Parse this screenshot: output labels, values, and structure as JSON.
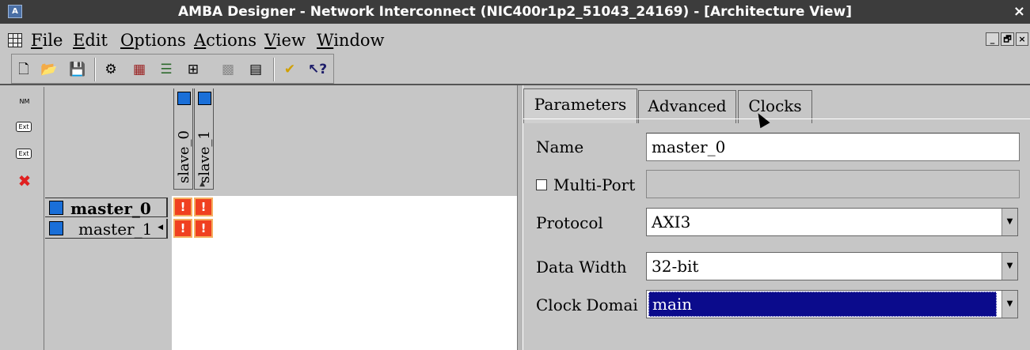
{
  "window": {
    "title": "AMBA Designer - Network Interconnect (NIC400r1p2_51043_24169) - [Architecture View]",
    "close_glyph": "×",
    "app_icon": "A"
  },
  "menubar": {
    "items": [
      {
        "label_u": "F",
        "label_rest": "ile"
      },
      {
        "label_u": "E",
        "label_rest": "dit"
      },
      {
        "label_u": "O",
        "label_rest": "ptions"
      },
      {
        "label_u": "A",
        "label_rest": "ctions"
      },
      {
        "label_u": "V",
        "label_rest": "iew"
      },
      {
        "label_u": "W",
        "label_rest": "indow"
      }
    ],
    "window_controls": [
      "_",
      "🗗",
      "×"
    ]
  },
  "toolbar": {
    "icons": [
      "new-file-icon",
      "open-folder-icon",
      "save-icon",
      "settings-gear-icon",
      "matrix-grid-icon",
      "list-view-icon",
      "connect-nodes-icon",
      "disabled-grid-icon",
      "properties-icon",
      "validate-check-icon",
      "context-help-icon"
    ],
    "glyphs": [
      "🗋",
      "📂",
      "💾",
      "⚙",
      "▦",
      "☰",
      "⊞",
      "▩",
      "▤",
      "✔",
      "↖?"
    ]
  },
  "side_toolbar": {
    "nm_label": "NM",
    "ext_out_label": "Ext",
    "ext_in_label": "Ext",
    "delete_glyph": "✖"
  },
  "matrix": {
    "slaves": [
      "slave_0",
      "slave_1"
    ],
    "masters": [
      "master_0",
      "master_1"
    ],
    "cell_symbol": "!",
    "colors": {
      "port": "#1a6fd8",
      "cell": "#f04020"
    }
  },
  "tabs": [
    "Parameters",
    "Advanced",
    "Clocks"
  ],
  "form": {
    "name_label": "Name",
    "name_value": "master_0",
    "multiport_label": "Multi-Port",
    "protocol_label": "Protocol",
    "protocol_value": "AXI3",
    "datawidth_label": "Data Width",
    "datawidth_value": "32-bit",
    "clock_label": "Clock Domai",
    "clock_value": "main",
    "selected_color": "#0b0b8c"
  }
}
